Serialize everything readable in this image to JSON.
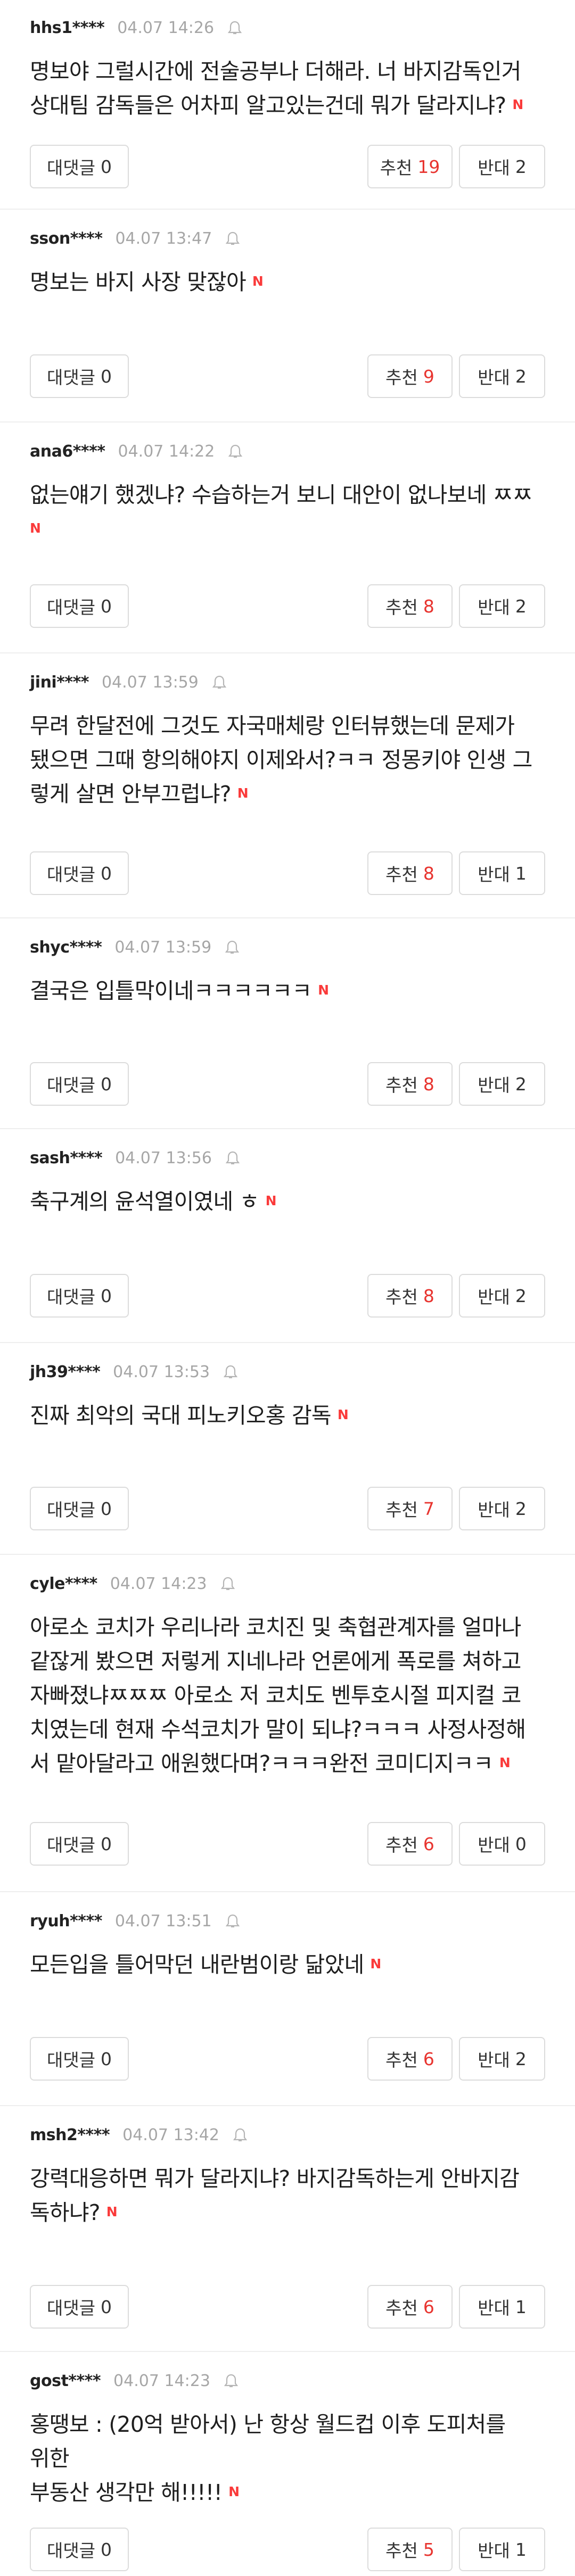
{
  "labels": {
    "reply": "대댓글",
    "like": "추천",
    "dislike": "반대",
    "new_mark": "N"
  },
  "comments": [
    {
      "nick": "hhs1****",
      "date": "04.07 14:26",
      "text": [
        "명보야 그럴시간에 전술공부나 더해라. 너 바지감독인거",
        "상대팀 감독들은 어차피 알고있는건데 뭐가 달라지냐?"
      ],
      "replies": "0",
      "likes": "19",
      "dislikes": "2"
    },
    {
      "nick": "sson****",
      "date": "04.07 13:47",
      "text": [
        "명보는 바지 사장 맞잖아"
      ],
      "replies": "0",
      "likes": "9",
      "dislikes": "2"
    },
    {
      "nick": "ana6****",
      "date": "04.07 14:22",
      "text": [
        "없는얘기 했겠냐? 수습하는거 보니 대안이 없나보네 ㅉㅉ",
        ""
      ],
      "replies": "0",
      "likes": "8",
      "dislikes": "2"
    },
    {
      "nick": "jini****",
      "date": "04.07 13:59",
      "text": [
        "무려 한달전에 그것도 자국매체랑 인터뷰했는데 문제가",
        "됐으면 그때 항의해야지 이제와서?ㅋㅋ 정몽키야 인생 그",
        "렇게 살면 안부끄럽냐?"
      ],
      "replies": "0",
      "likes": "8",
      "dislikes": "1"
    },
    {
      "nick": "shyc****",
      "date": "04.07 13:59",
      "text": [
        "결국은 입틀막이네ㅋㅋㅋㅋㅋㅋ"
      ],
      "replies": "0",
      "likes": "8",
      "dislikes": "2"
    },
    {
      "nick": "sash****",
      "date": "04.07 13:56",
      "text": [
        "축구계의 윤석열이였네 ㅎ"
      ],
      "replies": "0",
      "likes": "8",
      "dislikes": "2"
    },
    {
      "nick": "jh39****",
      "date": "04.07 13:53",
      "text": [
        "진짜 최악의 국대 피노키오홍 감독"
      ],
      "replies": "0",
      "likes": "7",
      "dislikes": "2"
    },
    {
      "nick": "cyle****",
      "date": "04.07 14:23",
      "text": [
        "아로소 코치가 우리나라 코치진 및 축협관계자를 얼마나",
        "같잖게 봤으면 저렇게 지네나라 언론에게 폭로를 쳐하고",
        "자빠졌냐ㅉㅉㅉ 아로소 저 코치도 벤투호시절 피지컬 코",
        "치였는데 현재 수석코치가 말이 되냐?ㅋㅋㅋ 사정사정해",
        "서 맡아달라고 애원했다며?ㅋㅋㅋ완전 코미디지ㅋㅋ"
      ],
      "replies": "0",
      "likes": "6",
      "dislikes": "0"
    },
    {
      "nick": "ryuh****",
      "date": "04.07 13:51",
      "text": [
        "모든입을 틀어막던 내란범이랑 닮았네"
      ],
      "replies": "0",
      "likes": "6",
      "dislikes": "2"
    },
    {
      "nick": "msh2****",
      "date": "04.07 13:42",
      "text": [
        "강력대응하면 뭐가 달라지냐? 바지감독하는게 안바지감",
        "독하냐?"
      ],
      "replies": "0",
      "likes": "6",
      "dislikes": "1"
    },
    {
      "nick": "gost****",
      "date": "04.07 14:23",
      "text": [
        "홍땡보 : (20억 받아서) 난 항상 월드컵 이후 도피처를 위한",
        "부동산 생각만 해!!!!!"
      ],
      "replies": "0",
      "likes": "5",
      "dislikes": "1"
    }
  ]
}
